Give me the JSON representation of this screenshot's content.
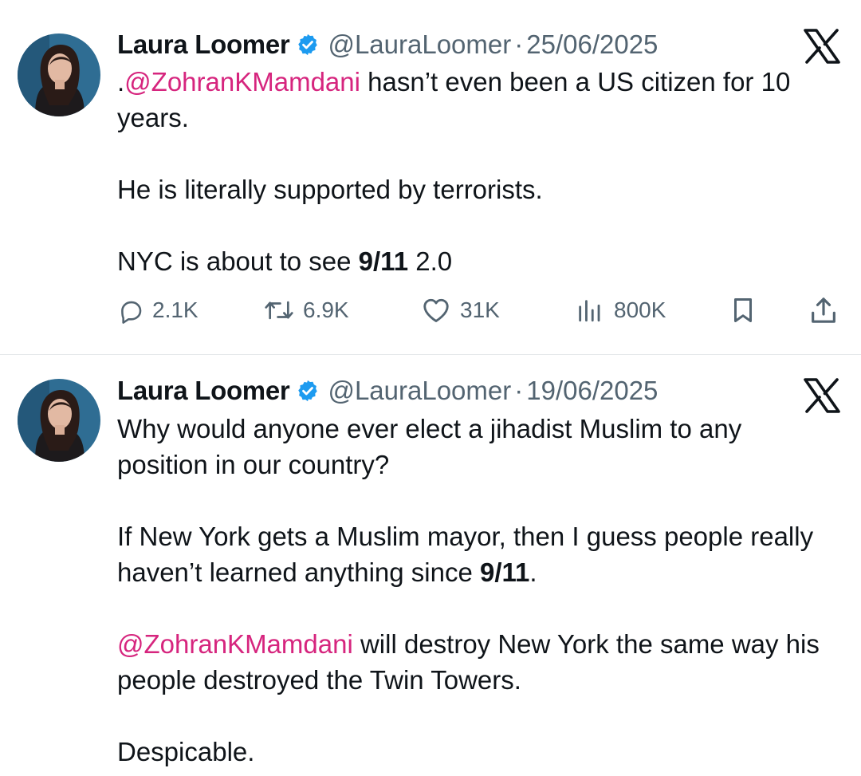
{
  "tweets": [
    {
      "author": "Laura Loomer",
      "handle": "@LauraLoomer",
      "separator": "·",
      "date": "25/06/2025",
      "para1_pre": ".",
      "para1_mention": "@ZohranKMamdani",
      "para1_rest": " hasn’t even been a US citizen for 10 years.",
      "para2": "He is literally supported by terrorists.",
      "para3_pre": "NYC is about to see ",
      "para3_bold": "9/11",
      "para3_post": " 2.0",
      "stats": {
        "replies": "2.1K",
        "reposts": "6.9K",
        "likes": "31K",
        "views": "800K"
      }
    },
    {
      "author": "Laura Loomer",
      "handle": "@LauraLoomer",
      "separator": "·",
      "date": "19/06/2025",
      "para1": "Why would anyone ever elect a jihadist Muslim to any position in our country?",
      "para2_pre": "If New York gets a Muslim mayor, then I guess people really haven’t learned anything since ",
      "para2_bold": "9/11",
      "para2_post": ".",
      "para3_mention": "@ZohranKMamdani",
      "para3_rest": " will destroy New York the same way his people destroyed the Twin Towers.",
      "para4": "Despicable."
    }
  ],
  "icons": {
    "avatar": "avatar-photo",
    "verified": "verified-badge-icon",
    "platform": "x-logo-icon",
    "reply": "reply-icon",
    "repost": "repost-icon",
    "like": "heart-icon",
    "views": "views-icon",
    "bookmark": "bookmark-icon",
    "share": "share-icon"
  },
  "colors": {
    "mention": "#d6257e",
    "secondary_text": "#536471",
    "verified": "#1d9bf0",
    "text": "#0f1419"
  }
}
